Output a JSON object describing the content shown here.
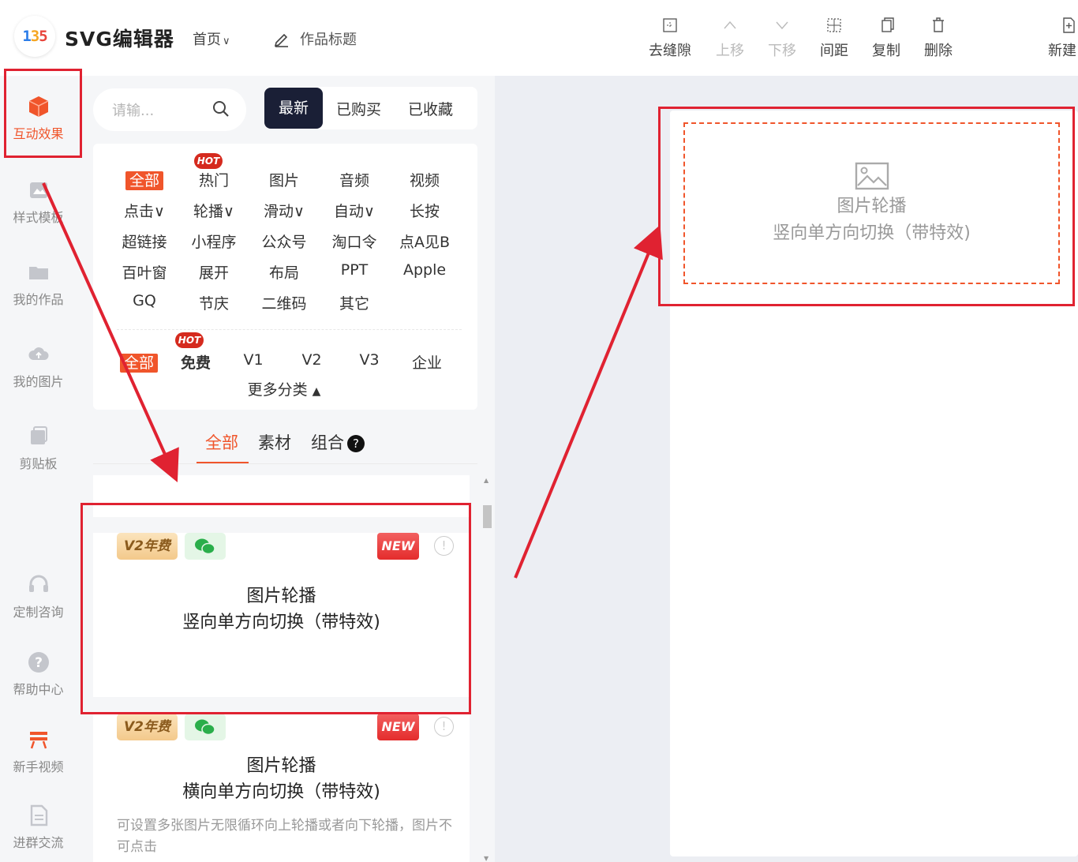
{
  "app": {
    "logo_text": "135",
    "title": "SVG编辑器",
    "home_menu": "首页",
    "work_title": "作品标题"
  },
  "toolbar": {
    "remove_gap": "去缝隙",
    "move_up": "上移",
    "move_down": "下移",
    "spacing": "间距",
    "copy": "复制",
    "delete": "删除",
    "new": "新建"
  },
  "leftnav": {
    "items": [
      {
        "label": "互动效果",
        "icon": "cube-icon"
      },
      {
        "label": "样式模板",
        "icon": "template-icon"
      },
      {
        "label": "我的作品",
        "icon": "folder-icon"
      },
      {
        "label": "我的图片",
        "icon": "cloud-icon"
      },
      {
        "label": "剪贴板",
        "icon": "clipboard-icon"
      },
      {
        "label": "定制咨询",
        "icon": "headset-icon"
      },
      {
        "label": "帮助中心",
        "icon": "help-icon"
      },
      {
        "label": "新手视频",
        "icon": "video-icon"
      },
      {
        "label": "进群交流",
        "icon": "doc-icon"
      }
    ]
  },
  "search": {
    "placeholder": "请输..."
  },
  "filter_tabs": [
    "最新",
    "已购买",
    "已收藏"
  ],
  "categories": {
    "rows": [
      [
        "全部",
        "热门",
        "图片",
        "音频",
        "视频"
      ],
      [
        "点击",
        "轮播",
        "滑动",
        "自动",
        "长按"
      ],
      [
        "超链接",
        "小程序",
        "公众号",
        "淘口令",
        "点A见B"
      ],
      [
        "百叶窗",
        "展开",
        "布局",
        "PPT",
        "Apple"
      ],
      [
        "GQ",
        "节庆",
        "二维码",
        "其它"
      ]
    ],
    "hot_label": "HOT",
    "tier_row": [
      "全部",
      "免费",
      "V1",
      "V2",
      "V3",
      "企业"
    ],
    "more": "更多分类"
  },
  "sub_tabs": [
    "全部",
    "素材",
    "组合"
  ],
  "cards": [
    {
      "badge_v2": "V2年费",
      "badge_new": "NEW",
      "title_line1": "图片轮播",
      "title_line2": "竖向单方向切换（带特效)"
    },
    {
      "badge_v2": "V2年费",
      "badge_new": "NEW",
      "title_line1": "图片轮播",
      "title_line2": "横向单方向切换（带特效)",
      "desc": "可设置多张图片无限循环向上轮播或者向下轮播，图片不可点击"
    }
  ],
  "canvas": {
    "placeholder_title": "图片轮播",
    "placeholder_sub": "竖向单方向切换（带特效)"
  },
  "colors": {
    "accent": "#f0552b",
    "annotation_red": "#e02231",
    "dark_tab": "#1a1f36"
  }
}
